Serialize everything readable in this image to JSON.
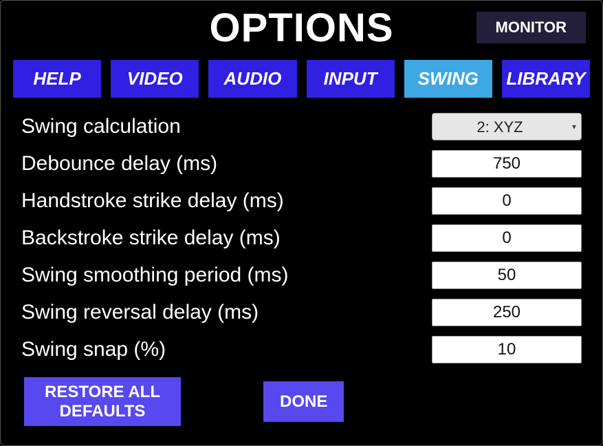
{
  "header": {
    "title": "OPTIONS",
    "monitor_label": "MONITOR"
  },
  "tabs": {
    "help": "HELP",
    "video": "VIDEO",
    "audio": "AUDIO",
    "input": "INPUT",
    "swing": "SWING",
    "library": "LIBRARY",
    "active": "swing"
  },
  "settings": {
    "swing_calculation": {
      "label": "Swing calculation",
      "value": "2: XYZ"
    },
    "debounce_delay": {
      "label": "Debounce delay (ms)",
      "value": "750"
    },
    "handstroke_delay": {
      "label": "Handstroke strike delay (ms)",
      "value": "0"
    },
    "backstroke_delay": {
      "label": "Backstroke strike delay (ms)",
      "value": "0"
    },
    "smoothing_period": {
      "label": "Swing smoothing period (ms)",
      "value": "50"
    },
    "reversal_delay": {
      "label": "Swing reversal delay (ms)",
      "value": "250"
    },
    "swing_snap": {
      "label": "Swing snap (%)",
      "value": "10"
    }
  },
  "footer": {
    "restore_label": "RESTORE ALL DEFAULTS",
    "done_label": "DONE"
  }
}
